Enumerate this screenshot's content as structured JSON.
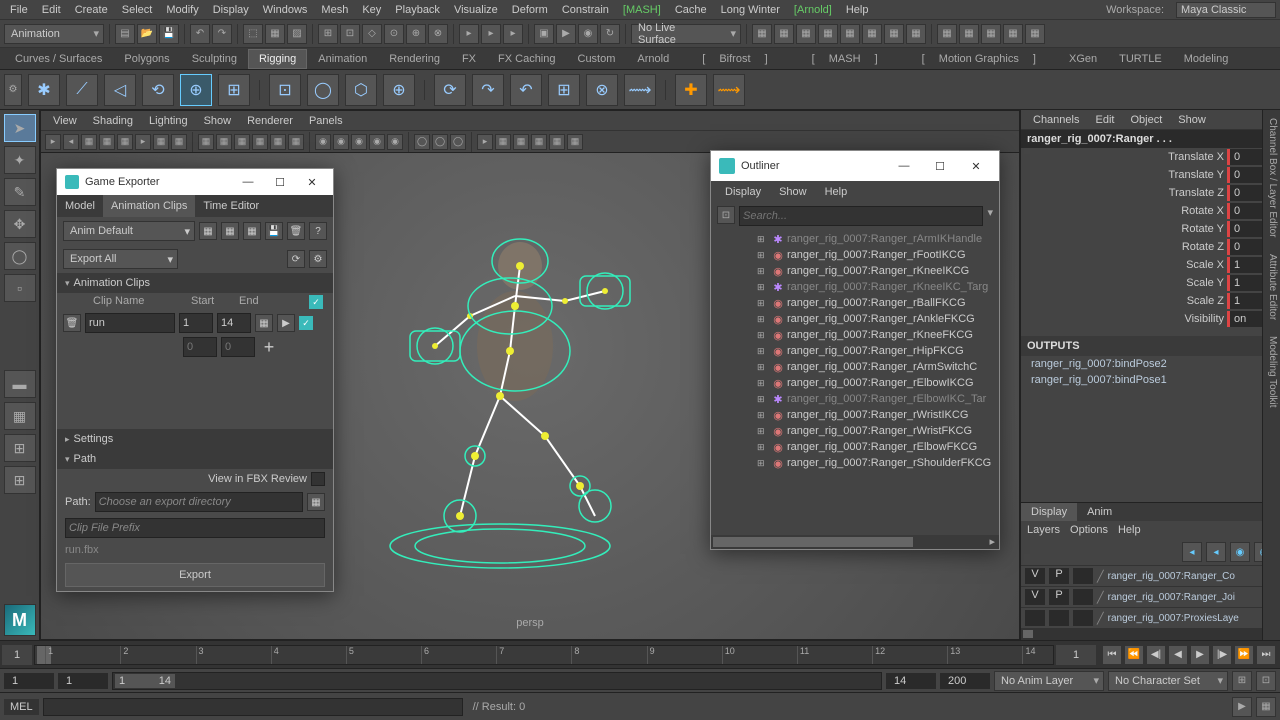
{
  "menubar": [
    "File",
    "Edit",
    "Create",
    "Select",
    "Modify",
    "Display",
    "Windows",
    "Mesh",
    "Key",
    "Playback",
    "Visualize",
    "Deform",
    "Constrain",
    "[MASH]",
    "Cache",
    "Long Winter",
    "[Arnold]",
    "Help"
  ],
  "menubar_green": [
    13,
    16
  ],
  "workspace": {
    "label": "Workspace:",
    "value": "Maya Classic"
  },
  "mode_dropdown": "Animation",
  "live_surface": "No Live Surface",
  "shelf_tabs": [
    "Curves / Surfaces",
    "Polygons",
    "Sculpting",
    "Rigging",
    "Animation",
    "Rendering",
    "FX",
    "FX Caching",
    "Custom",
    "Arnold",
    "Bifrost",
    "MASH",
    "Motion Graphics",
    "XGen",
    "TURTLE",
    "Modeling"
  ],
  "shelf_bracketed": [
    10,
    11,
    12
  ],
  "shelf_active": 3,
  "vp_menu": [
    "View",
    "Shading",
    "Lighting",
    "Show",
    "Renderer",
    "Panels"
  ],
  "camera_label": "persp",
  "channel_menu": [
    "Channels",
    "Edit",
    "Object",
    "Show"
  ],
  "channel_node": "ranger_rig_0007:Ranger . . .",
  "channels": [
    {
      "label": "Translate X",
      "val": "0",
      "red": true
    },
    {
      "label": "Translate Y",
      "val": "0",
      "red": true
    },
    {
      "label": "Translate Z",
      "val": "0",
      "red": true
    },
    {
      "label": "Rotate X",
      "val": "0",
      "red": true
    },
    {
      "label": "Rotate Y",
      "val": "0",
      "red": true
    },
    {
      "label": "Rotate Z",
      "val": "0",
      "red": true
    },
    {
      "label": "Scale X",
      "val": "1",
      "red": true
    },
    {
      "label": "Scale Y",
      "val": "1",
      "red": true
    },
    {
      "label": "Scale Z",
      "val": "1",
      "red": true
    },
    {
      "label": "Visibility",
      "val": "on",
      "red": true
    }
  ],
  "outputs_header": "OUTPUTS",
  "outputs": [
    "ranger_rig_0007:bindPose2",
    "ranger_rig_0007:bindPose1"
  ],
  "layer_tabs": [
    "Display",
    "Anim"
  ],
  "layer_menu": [
    "Layers",
    "Options",
    "Help"
  ],
  "layers": [
    {
      "v": "V",
      "p": "P",
      "name": "ranger_rig_0007:Ranger_Co"
    },
    {
      "v": "V",
      "p": "P",
      "name": "ranger_rig_0007:Ranger_Joi"
    },
    {
      "v": "",
      "p": "",
      "name": "ranger_rig_0007:ProxiesLaye"
    }
  ],
  "side_tabs": [
    "Channel Box / Layer Editor",
    "Attribute Editor",
    "Modeling Toolkit"
  ],
  "timeline": {
    "start_disp": "1",
    "cursor": "1",
    "ticks": [
      "1",
      "2",
      "3",
      "4",
      "5",
      "6",
      "7",
      "8",
      "9",
      "10",
      "11",
      "12",
      "13",
      "14"
    ]
  },
  "range": {
    "a": "1",
    "b": "1",
    "slider_a": "1",
    "slider_b": "14",
    "c": "14",
    "d": "200",
    "anim_layer": "No Anim Layer",
    "char_set": "No Character Set"
  },
  "cmd": {
    "lang": "MEL",
    "result": "// Result: 0"
  },
  "outliner": {
    "title": "Outliner",
    "menu": [
      "Display",
      "Show",
      "Help"
    ],
    "search_placeholder": "Search...",
    "items": [
      {
        "name": "ranger_rig_0007:Ranger_rArmIKHandle",
        "dim": true,
        "icon": "loc"
      },
      {
        "name": "ranger_rig_0007:Ranger_rFootIKCG",
        "icon": "nurbs"
      },
      {
        "name": "ranger_rig_0007:Ranger_rKneeIKCG",
        "icon": "nurbs"
      },
      {
        "name": "ranger_rig_0007:Ranger_rKneeIKC_Targ",
        "dim": true,
        "icon": "loc"
      },
      {
        "name": "ranger_rig_0007:Ranger_rBallFKCG",
        "icon": "nurbs"
      },
      {
        "name": "ranger_rig_0007:Ranger_rAnkleFKCG",
        "icon": "nurbs"
      },
      {
        "name": "ranger_rig_0007:Ranger_rKneeFKCG",
        "icon": "nurbs"
      },
      {
        "name": "ranger_rig_0007:Ranger_rHipFKCG",
        "icon": "nurbs"
      },
      {
        "name": "ranger_rig_0007:Ranger_rArmSwitchC",
        "icon": "nurbs"
      },
      {
        "name": "ranger_rig_0007:Ranger_rElbowIKCG",
        "icon": "nurbs"
      },
      {
        "name": "ranger_rig_0007:Ranger_rElbowIKC_Tar",
        "dim": true,
        "icon": "loc"
      },
      {
        "name": "ranger_rig_0007:Ranger_rWristIKCG",
        "icon": "nurbs"
      },
      {
        "name": "ranger_rig_0007:Ranger_rWristFKCG",
        "icon": "nurbs"
      },
      {
        "name": "ranger_rig_0007:Ranger_rElbowFKCG",
        "icon": "nurbs"
      },
      {
        "name": "ranger_rig_0007:Ranger_rShoulderFKCG",
        "icon": "nurbs"
      }
    ]
  },
  "game_exporter": {
    "title": "Game Exporter",
    "tabs": [
      "Model",
      "Animation Clips",
      "Time Editor"
    ],
    "tabs_active": 1,
    "preset": "Anim Default",
    "export_scope": "Export All",
    "section_clips": "Animation Clips",
    "col_clip": "Clip Name",
    "col_start": "Start",
    "col_end": "End",
    "clip_name": "run",
    "clip_start": "1",
    "clip_end": "14",
    "blank_start": "0",
    "blank_end": "0",
    "section_settings": "Settings",
    "section_path": "Path",
    "fbx_review": "View in FBX Review",
    "path_label": "Path:",
    "path_placeholder": "Choose an export directory",
    "prefix_placeholder": "Clip File Prefix",
    "filename": "run.fbx",
    "export_btn": "Export"
  }
}
